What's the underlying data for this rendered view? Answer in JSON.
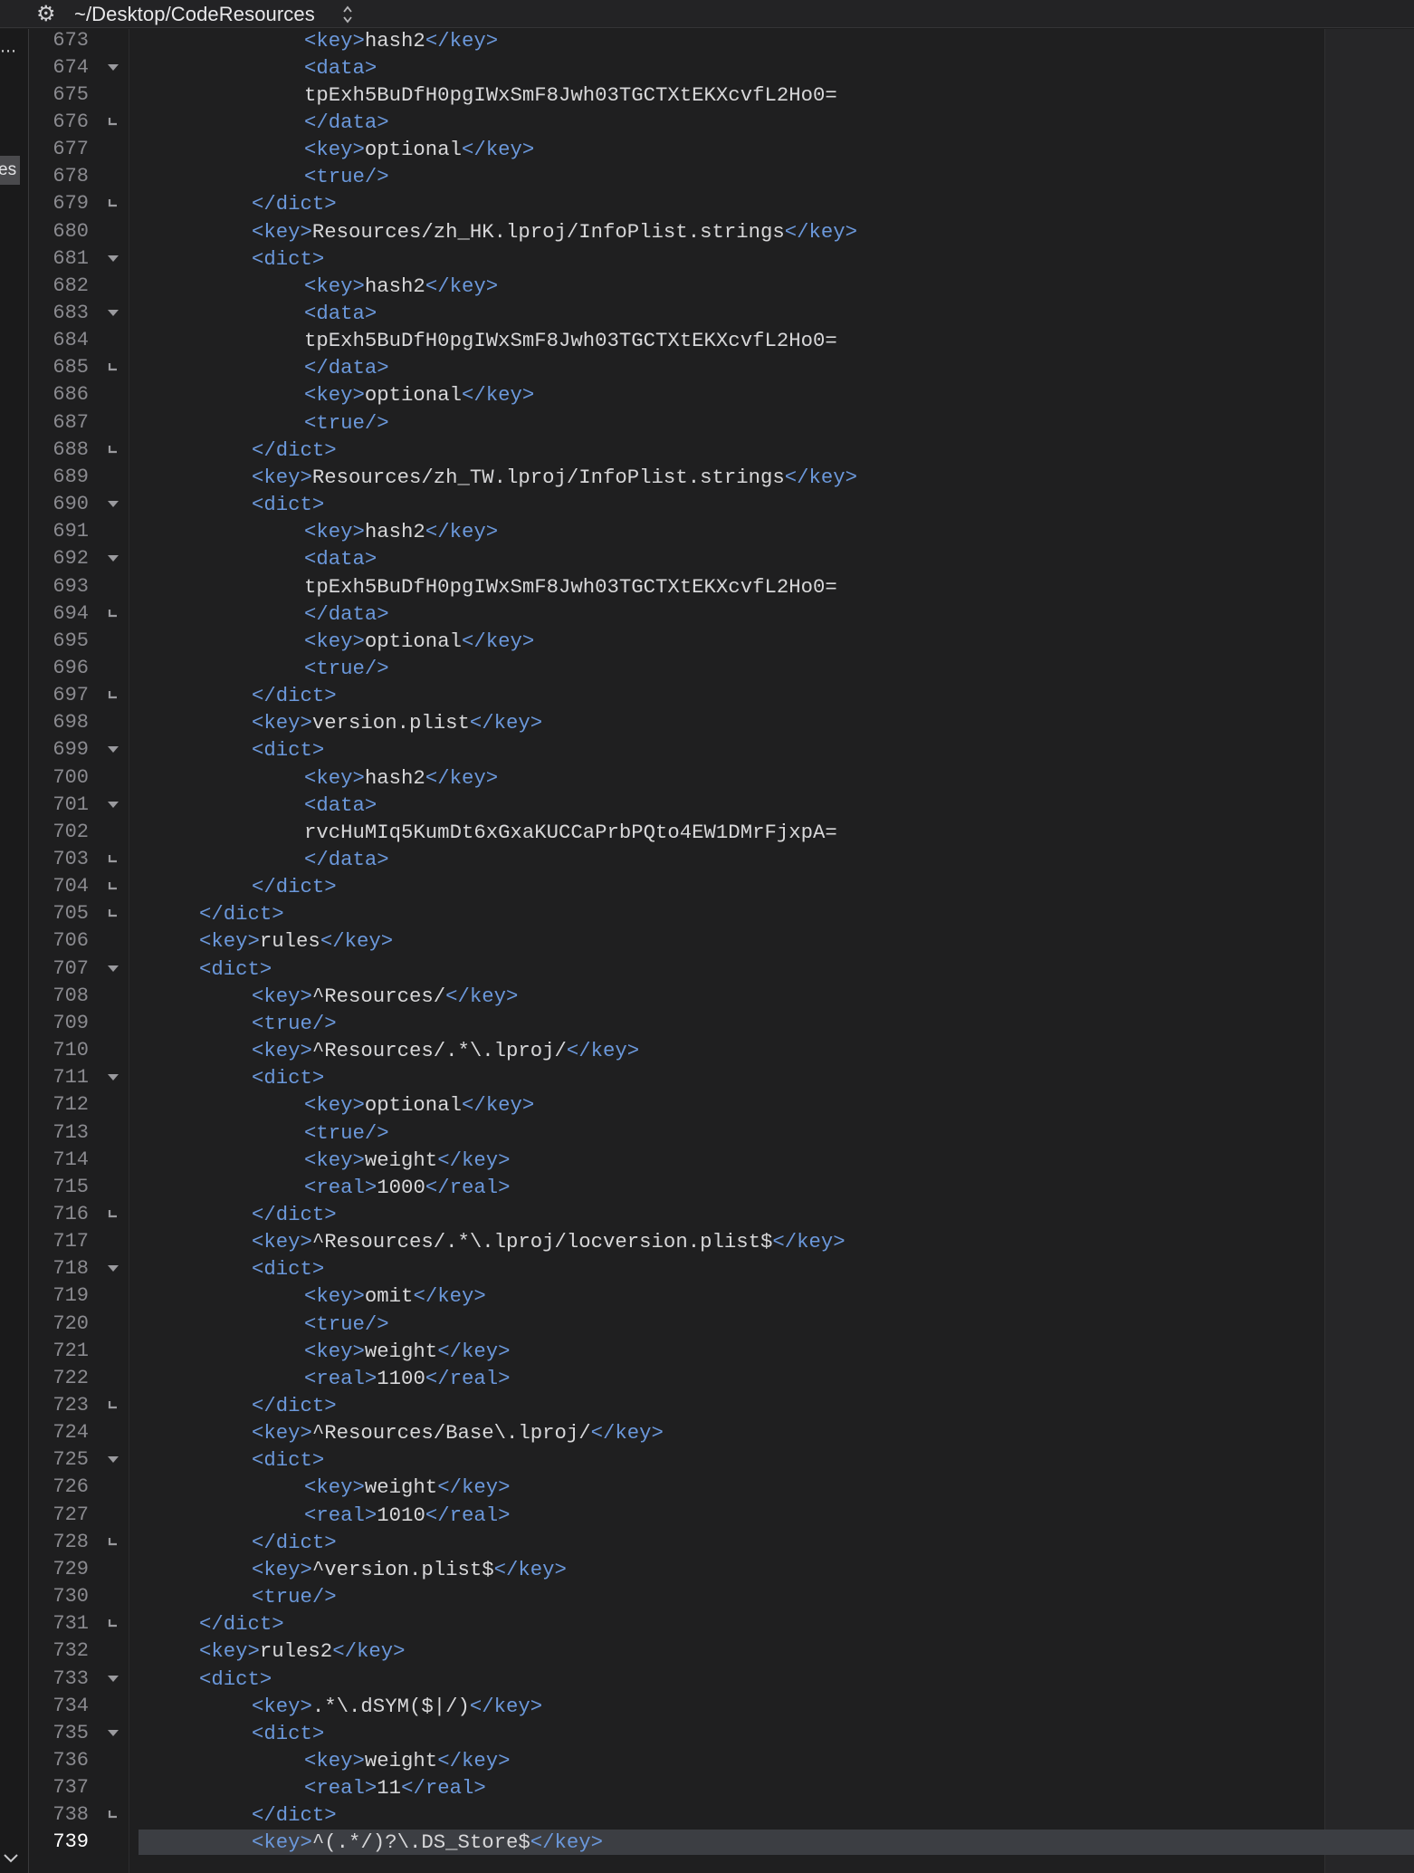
{
  "titlebar": {
    "path": "~/Desktop/CodeResources",
    "gear_icon": "gear-icon",
    "stepper_icon": "up-down-chevron-icon"
  },
  "sidebar": {
    "tab_fragment": "es",
    "more_icon": "ellipsis-icon",
    "collapse_icon": "chevron-down-icon"
  },
  "colors": {
    "background": "#1e1e1f",
    "tag": "#6b98db",
    "text": "#d7d7d9",
    "line_number": "#8a8a8f",
    "current_line": "#3c3e43"
  },
  "editor": {
    "current_line": "739",
    "lines": [
      {
        "n": "673",
        "fold": "",
        "indent": 3,
        "parts": [
          [
            "<key>",
            1
          ],
          [
            "hash2",
            0
          ],
          [
            "</key>",
            1
          ]
        ]
      },
      {
        "n": "674",
        "fold": "open",
        "indent": 3,
        "parts": [
          [
            "<data>",
            1
          ]
        ]
      },
      {
        "n": "675",
        "fold": "",
        "indent": 3,
        "parts": [
          [
            "tpExh5BuDfH0pgIWxSmF8Jwh03TGCTXtEKXcvfL2Ho0=",
            0
          ]
        ]
      },
      {
        "n": "676",
        "fold": "end",
        "indent": 3,
        "parts": [
          [
            "</data>",
            1
          ]
        ]
      },
      {
        "n": "677",
        "fold": "",
        "indent": 3,
        "parts": [
          [
            "<key>",
            1
          ],
          [
            "optional",
            0
          ],
          [
            "</key>",
            1
          ]
        ]
      },
      {
        "n": "678",
        "fold": "",
        "indent": 3,
        "parts": [
          [
            "<true/>",
            1
          ]
        ]
      },
      {
        "n": "679",
        "fold": "end",
        "indent": 2,
        "parts": [
          [
            "</dict>",
            1
          ]
        ]
      },
      {
        "n": "680",
        "fold": "",
        "indent": 2,
        "parts": [
          [
            "<key>",
            1
          ],
          [
            "Resources/zh_HK.lproj/InfoPlist.strings",
            0
          ],
          [
            "</key>",
            1
          ]
        ]
      },
      {
        "n": "681",
        "fold": "open",
        "indent": 2,
        "parts": [
          [
            "<dict>",
            1
          ]
        ]
      },
      {
        "n": "682",
        "fold": "",
        "indent": 3,
        "parts": [
          [
            "<key>",
            1
          ],
          [
            "hash2",
            0
          ],
          [
            "</key>",
            1
          ]
        ]
      },
      {
        "n": "683",
        "fold": "open",
        "indent": 3,
        "parts": [
          [
            "<data>",
            1
          ]
        ]
      },
      {
        "n": "684",
        "fold": "",
        "indent": 3,
        "parts": [
          [
            "tpExh5BuDfH0pgIWxSmF8Jwh03TGCTXtEKXcvfL2Ho0=",
            0
          ]
        ]
      },
      {
        "n": "685",
        "fold": "end",
        "indent": 3,
        "parts": [
          [
            "</data>",
            1
          ]
        ]
      },
      {
        "n": "686",
        "fold": "",
        "indent": 3,
        "parts": [
          [
            "<key>",
            1
          ],
          [
            "optional",
            0
          ],
          [
            "</key>",
            1
          ]
        ]
      },
      {
        "n": "687",
        "fold": "",
        "indent": 3,
        "parts": [
          [
            "<true/>",
            1
          ]
        ]
      },
      {
        "n": "688",
        "fold": "end",
        "indent": 2,
        "parts": [
          [
            "</dict>",
            1
          ]
        ]
      },
      {
        "n": "689",
        "fold": "",
        "indent": 2,
        "parts": [
          [
            "<key>",
            1
          ],
          [
            "Resources/zh_TW.lproj/InfoPlist.strings",
            0
          ],
          [
            "</key>",
            1
          ]
        ]
      },
      {
        "n": "690",
        "fold": "open",
        "indent": 2,
        "parts": [
          [
            "<dict>",
            1
          ]
        ]
      },
      {
        "n": "691",
        "fold": "",
        "indent": 3,
        "parts": [
          [
            "<key>",
            1
          ],
          [
            "hash2",
            0
          ],
          [
            "</key>",
            1
          ]
        ]
      },
      {
        "n": "692",
        "fold": "open",
        "indent": 3,
        "parts": [
          [
            "<data>",
            1
          ]
        ]
      },
      {
        "n": "693",
        "fold": "",
        "indent": 3,
        "parts": [
          [
            "tpExh5BuDfH0pgIWxSmF8Jwh03TGCTXtEKXcvfL2Ho0=",
            0
          ]
        ]
      },
      {
        "n": "694",
        "fold": "end",
        "indent": 3,
        "parts": [
          [
            "</data>",
            1
          ]
        ]
      },
      {
        "n": "695",
        "fold": "",
        "indent": 3,
        "parts": [
          [
            "<key>",
            1
          ],
          [
            "optional",
            0
          ],
          [
            "</key>",
            1
          ]
        ]
      },
      {
        "n": "696",
        "fold": "",
        "indent": 3,
        "parts": [
          [
            "<true/>",
            1
          ]
        ]
      },
      {
        "n": "697",
        "fold": "end",
        "indent": 2,
        "parts": [
          [
            "</dict>",
            1
          ]
        ]
      },
      {
        "n": "698",
        "fold": "",
        "indent": 2,
        "parts": [
          [
            "<key>",
            1
          ],
          [
            "version.plist",
            0
          ],
          [
            "</key>",
            1
          ]
        ]
      },
      {
        "n": "699",
        "fold": "open",
        "indent": 2,
        "parts": [
          [
            "<dict>",
            1
          ]
        ]
      },
      {
        "n": "700",
        "fold": "",
        "indent": 3,
        "parts": [
          [
            "<key>",
            1
          ],
          [
            "hash2",
            0
          ],
          [
            "</key>",
            1
          ]
        ]
      },
      {
        "n": "701",
        "fold": "open",
        "indent": 3,
        "parts": [
          [
            "<data>",
            1
          ]
        ]
      },
      {
        "n": "702",
        "fold": "",
        "indent": 3,
        "parts": [
          [
            "rvcHuMIq5KumDt6xGxaKUCCaPrbPQto4EW1DMrFjxpA=",
            0
          ]
        ]
      },
      {
        "n": "703",
        "fold": "end",
        "indent": 3,
        "parts": [
          [
            "</data>",
            1
          ]
        ]
      },
      {
        "n": "704",
        "fold": "end",
        "indent": 2,
        "parts": [
          [
            "</dict>",
            1
          ]
        ]
      },
      {
        "n": "705",
        "fold": "end",
        "indent": 1,
        "parts": [
          [
            "</dict>",
            1
          ]
        ]
      },
      {
        "n": "706",
        "fold": "",
        "indent": 1,
        "parts": [
          [
            "<key>",
            1
          ],
          [
            "rules",
            0
          ],
          [
            "</key>",
            1
          ]
        ]
      },
      {
        "n": "707",
        "fold": "open",
        "indent": 1,
        "parts": [
          [
            "<dict>",
            1
          ]
        ]
      },
      {
        "n": "708",
        "fold": "",
        "indent": 2,
        "parts": [
          [
            "<key>",
            1
          ],
          [
            "^Resources/",
            0
          ],
          [
            "</key>",
            1
          ]
        ]
      },
      {
        "n": "709",
        "fold": "",
        "indent": 2,
        "parts": [
          [
            "<true/>",
            1
          ]
        ]
      },
      {
        "n": "710",
        "fold": "",
        "indent": 2,
        "parts": [
          [
            "<key>",
            1
          ],
          [
            "^Resources/.*\\.lproj/",
            0
          ],
          [
            "</key>",
            1
          ]
        ]
      },
      {
        "n": "711",
        "fold": "open",
        "indent": 2,
        "parts": [
          [
            "<dict>",
            1
          ]
        ]
      },
      {
        "n": "712",
        "fold": "",
        "indent": 3,
        "parts": [
          [
            "<key>",
            1
          ],
          [
            "optional",
            0
          ],
          [
            "</key>",
            1
          ]
        ]
      },
      {
        "n": "713",
        "fold": "",
        "indent": 3,
        "parts": [
          [
            "<true/>",
            1
          ]
        ]
      },
      {
        "n": "714",
        "fold": "",
        "indent": 3,
        "parts": [
          [
            "<key>",
            1
          ],
          [
            "weight",
            0
          ],
          [
            "</key>",
            1
          ]
        ]
      },
      {
        "n": "715",
        "fold": "",
        "indent": 3,
        "parts": [
          [
            "<real>",
            1
          ],
          [
            "1000",
            0
          ],
          [
            "</real>",
            1
          ]
        ]
      },
      {
        "n": "716",
        "fold": "end",
        "indent": 2,
        "parts": [
          [
            "</dict>",
            1
          ]
        ]
      },
      {
        "n": "717",
        "fold": "",
        "indent": 2,
        "parts": [
          [
            "<key>",
            1
          ],
          [
            "^Resources/.*\\.lproj/locversion.plist$",
            0
          ],
          [
            "</key>",
            1
          ]
        ]
      },
      {
        "n": "718",
        "fold": "open",
        "indent": 2,
        "parts": [
          [
            "<dict>",
            1
          ]
        ]
      },
      {
        "n": "719",
        "fold": "",
        "indent": 3,
        "parts": [
          [
            "<key>",
            1
          ],
          [
            "omit",
            0
          ],
          [
            "</key>",
            1
          ]
        ]
      },
      {
        "n": "720",
        "fold": "",
        "indent": 3,
        "parts": [
          [
            "<true/>",
            1
          ]
        ]
      },
      {
        "n": "721",
        "fold": "",
        "indent": 3,
        "parts": [
          [
            "<key>",
            1
          ],
          [
            "weight",
            0
          ],
          [
            "</key>",
            1
          ]
        ]
      },
      {
        "n": "722",
        "fold": "",
        "indent": 3,
        "parts": [
          [
            "<real>",
            1
          ],
          [
            "1100",
            0
          ],
          [
            "</real>",
            1
          ]
        ]
      },
      {
        "n": "723",
        "fold": "end",
        "indent": 2,
        "parts": [
          [
            "</dict>",
            1
          ]
        ]
      },
      {
        "n": "724",
        "fold": "",
        "indent": 2,
        "parts": [
          [
            "<key>",
            1
          ],
          [
            "^Resources/Base\\.lproj/",
            0
          ],
          [
            "</key>",
            1
          ]
        ]
      },
      {
        "n": "725",
        "fold": "open",
        "indent": 2,
        "parts": [
          [
            "<dict>",
            1
          ]
        ]
      },
      {
        "n": "726",
        "fold": "",
        "indent": 3,
        "parts": [
          [
            "<key>",
            1
          ],
          [
            "weight",
            0
          ],
          [
            "</key>",
            1
          ]
        ]
      },
      {
        "n": "727",
        "fold": "",
        "indent": 3,
        "parts": [
          [
            "<real>",
            1
          ],
          [
            "1010",
            0
          ],
          [
            "</real>",
            1
          ]
        ]
      },
      {
        "n": "728",
        "fold": "end",
        "indent": 2,
        "parts": [
          [
            "</dict>",
            1
          ]
        ]
      },
      {
        "n": "729",
        "fold": "",
        "indent": 2,
        "parts": [
          [
            "<key>",
            1
          ],
          [
            "^version.plist$",
            0
          ],
          [
            "</key>",
            1
          ]
        ]
      },
      {
        "n": "730",
        "fold": "",
        "indent": 2,
        "parts": [
          [
            "<true/>",
            1
          ]
        ]
      },
      {
        "n": "731",
        "fold": "end",
        "indent": 1,
        "parts": [
          [
            "</dict>",
            1
          ]
        ]
      },
      {
        "n": "732",
        "fold": "",
        "indent": 1,
        "parts": [
          [
            "<key>",
            1
          ],
          [
            "rules2",
            0
          ],
          [
            "</key>",
            1
          ]
        ]
      },
      {
        "n": "733",
        "fold": "open",
        "indent": 1,
        "parts": [
          [
            "<dict>",
            1
          ]
        ]
      },
      {
        "n": "734",
        "fold": "",
        "indent": 2,
        "parts": [
          [
            "<key>",
            1
          ],
          [
            ".*\\.dSYM($|/)",
            0
          ],
          [
            "</key>",
            1
          ]
        ]
      },
      {
        "n": "735",
        "fold": "open",
        "indent": 2,
        "parts": [
          [
            "<dict>",
            1
          ]
        ]
      },
      {
        "n": "736",
        "fold": "",
        "indent": 3,
        "parts": [
          [
            "<key>",
            1
          ],
          [
            "weight",
            0
          ],
          [
            "</key>",
            1
          ]
        ]
      },
      {
        "n": "737",
        "fold": "",
        "indent": 3,
        "parts": [
          [
            "<real>",
            1
          ],
          [
            "11",
            0
          ],
          [
            "</real>",
            1
          ]
        ]
      },
      {
        "n": "738",
        "fold": "end",
        "indent": 2,
        "parts": [
          [
            "</dict>",
            1
          ]
        ]
      },
      {
        "n": "739",
        "fold": "",
        "indent": 2,
        "parts": [
          [
            "<key>",
            1
          ],
          [
            "^(.*/)?\\.DS_Store$",
            0
          ],
          [
            "</key>",
            1
          ]
        ]
      }
    ]
  }
}
